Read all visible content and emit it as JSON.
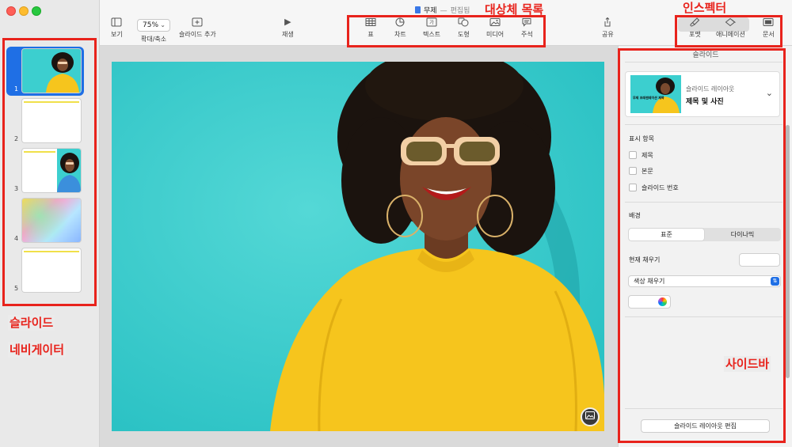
{
  "window": {
    "title": "무제",
    "status": "편집됨"
  },
  "toolbar": {
    "view": "보기",
    "zoom_value": "75%",
    "zoom_label": "확대/축소",
    "add_slide": "슬라이드 추가",
    "play": "재생",
    "table": "표",
    "chart": "차트",
    "text": "텍스트",
    "shape": "도형",
    "media": "미디어",
    "comment": "주석",
    "share": "공유",
    "format": "포맷",
    "animate": "애니메이션",
    "document": "문서"
  },
  "navigator": {
    "slides": [
      {
        "number": "1",
        "selected": true
      },
      {
        "number": "2"
      },
      {
        "number": "3"
      },
      {
        "number": "4"
      },
      {
        "number": "5"
      }
    ]
  },
  "annotations": {
    "object_list": "대상체 목록",
    "inspector": "인스펙터",
    "navigator_line1": "슬라이드",
    "navigator_line2": "네비게이터",
    "sidebar": "사이드바"
  },
  "inspector": {
    "header": "슬라이드",
    "layout_thumb_title": "무제 프레젠테이션 제목",
    "layout_sub": "슬라이드 레이아웃",
    "layout_name": "제목 및 사진",
    "display_items_title": "표시 항목",
    "checkbox_title": "제목",
    "checkbox_body": "본문",
    "checkbox_slide_number": "슬라이드 번호",
    "background_title": "배경",
    "seg_standard": "표준",
    "seg_dynamic": "다이나믹",
    "current_fill": "현재 채우기",
    "fill_type": "색상 채우기",
    "edit_layout_button": "슬라이드 레이아웃 편집"
  },
  "colors": {
    "accent": "#1f6fe5",
    "annotation": "#e8231c",
    "slide_background": "#3ccfcf",
    "sweater": "#f6c51d"
  }
}
